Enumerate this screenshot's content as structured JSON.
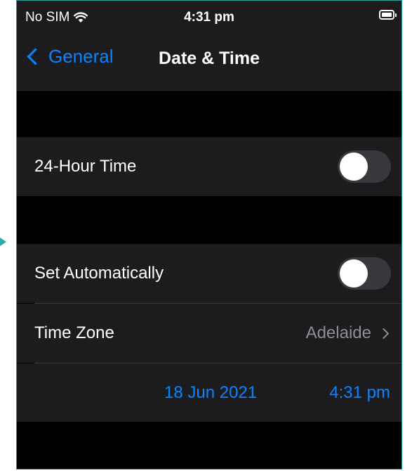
{
  "status_bar": {
    "carrier": "No SIM",
    "time": "4:31 pm",
    "wifi_icon": "wifi-icon",
    "battery_icon": "battery-icon"
  },
  "nav": {
    "back_label": "General",
    "title": "Date & Time"
  },
  "settings": {
    "hour24": {
      "label": "24-Hour Time",
      "enabled": false
    },
    "set_automatically": {
      "label": "Set Automatically",
      "enabled": false
    },
    "time_zone": {
      "label": "Time Zone",
      "value": "Adelaide"
    },
    "date": "18 Jun 2021",
    "time": "4:31 pm"
  },
  "colors": {
    "accent": "#0a84ff",
    "cell_background": "#1c1c1e",
    "screen_background": "#000000",
    "frame_border": "#1fa39e"
  }
}
